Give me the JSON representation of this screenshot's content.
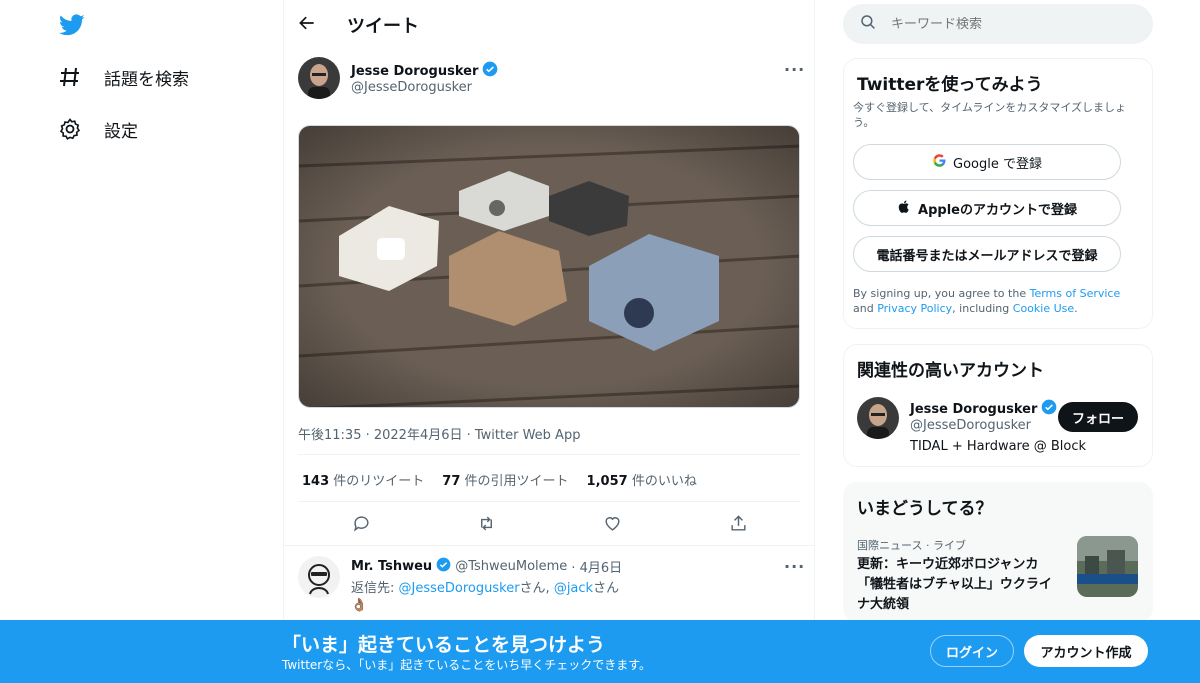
{
  "nav": {
    "explore_label": "話題を検索",
    "settings_label": "設定"
  },
  "header": {
    "title": "ツイート"
  },
  "tweet": {
    "author_name": "Jesse Dorogusker",
    "author_handle": "@JesseDorogusker",
    "timestamp": "午後11:35 · 2022年4月6日 · Twitter Web App",
    "retweets_count": "143",
    "retweets_label": "件のリツイート",
    "quotes_count": "77",
    "quotes_label": "件の引用ツイート",
    "likes_count": "1,057",
    "likes_label": "件のいいね"
  },
  "reply": {
    "author_name": "Mr. Tshweu",
    "author_handle": "@TshweuMoleme",
    "date": "· 4月6日",
    "prefix": "返信先: ",
    "mention1": "@JesseDorogusker",
    "san1": "さん, ",
    "mention2": "@jack",
    "san2": "さん",
    "emoji": "👌🏽"
  },
  "search": {
    "placeholder": "キーワード検索"
  },
  "signup": {
    "title": "Twitterを使ってみよう",
    "subtitle": "今すぐ登録して、タイムラインをカスタマイズしましょう。",
    "google_label": "Google で登録",
    "apple_label": "Appleのアカウントで登録",
    "phone_label": "電話番号またはメールアドレスで登録",
    "legal_prefix": "By signing up, you agree to the ",
    "terms": "Terms of Service",
    "and": " and ",
    "privacy": "Privacy Policy",
    "including": ", including ",
    "cookie": "Cookie Use",
    "period": "."
  },
  "related": {
    "title": "関連性の高いアカウント",
    "name": "Jesse Dorogusker",
    "handle": "@JesseDorogusker",
    "bio": "TIDAL + Hardware @ Block",
    "follow_label": "フォロー"
  },
  "trends": {
    "title": "いまどうしてる？",
    "category": "国際ニュース · ライブ",
    "headline": "更新：キーウ近郊ボロジャンカ「犠牲者はブチャ以上」ウクライナ大統領"
  },
  "banner": {
    "title": "「いま」起きていることを見つけよう",
    "subtitle": "Twitterなら、「いま」起きていることをいち早くチェックできます。",
    "login_label": "ログイン",
    "create_label": "アカウント作成"
  },
  "colors": {
    "brand": "#1d9bf0",
    "text": "#0f1419",
    "muted": "#536471"
  }
}
